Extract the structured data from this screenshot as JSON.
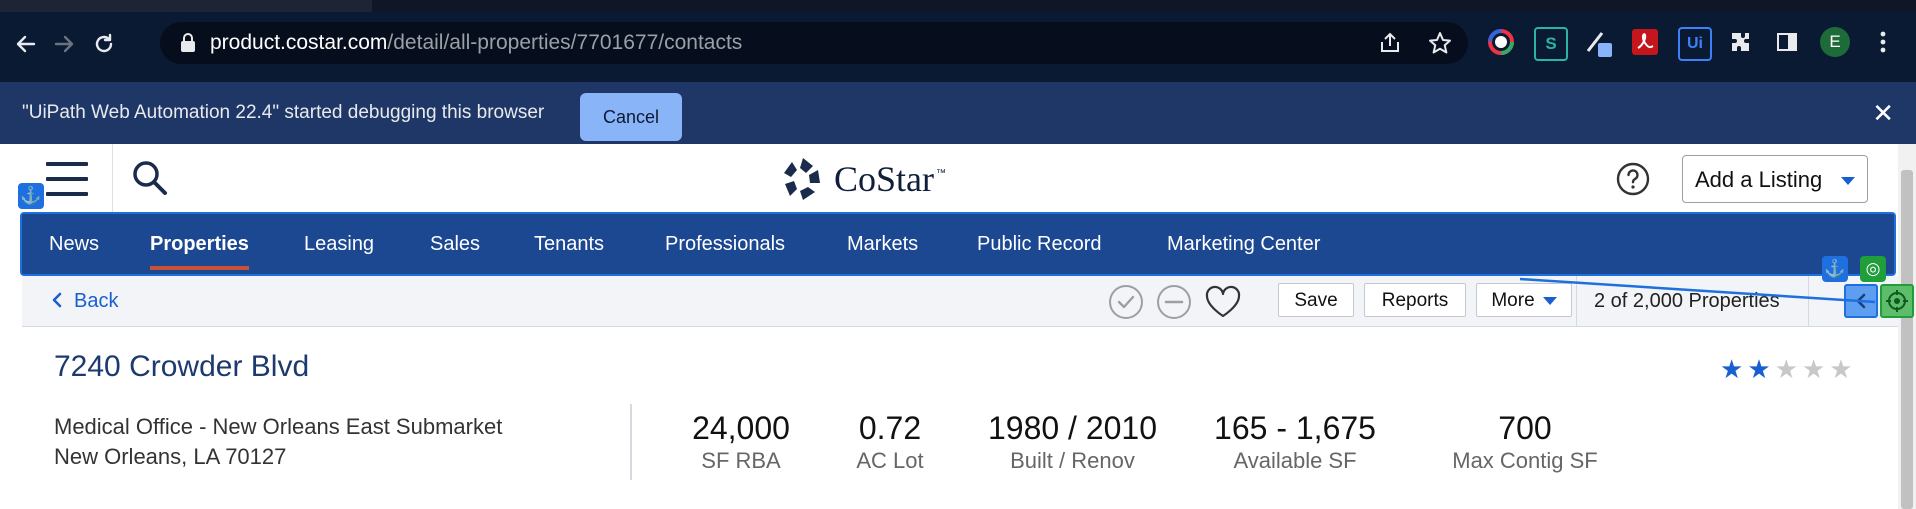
{
  "browser": {
    "url_domain": "product.costar.com",
    "url_path": "/detail/all-properties/7701677/contacts",
    "profile_initial": "E",
    "extensions": [
      "color-picker-icon",
      "s-extension-icon",
      "pen-extension-icon",
      "pdf-extension-icon",
      "uipath-extension-icon",
      "puzzle-icon",
      "sidepanel-icon"
    ]
  },
  "infobar": {
    "message": "\"UiPath Web Automation 22.4\" started debugging this browser",
    "cancel_label": "Cancel",
    "close_symbol": "✕"
  },
  "header": {
    "brand": "CoStar",
    "trademark": "™",
    "add_listing_label": "Add a Listing"
  },
  "nav": {
    "items": [
      {
        "label": "News"
      },
      {
        "label": "Properties"
      },
      {
        "label": "Leasing"
      },
      {
        "label": "Sales"
      },
      {
        "label": "Tenants"
      },
      {
        "label": "Professionals"
      },
      {
        "label": "Markets"
      },
      {
        "label": "Public Record"
      },
      {
        "label": "Marketing Center"
      }
    ],
    "active": "Properties"
  },
  "actions": {
    "back_label": "Back",
    "save_label": "Save",
    "reports_label": "Reports",
    "more_label": "More",
    "pager_text": "2 of 2,000 Properties"
  },
  "property": {
    "title": "7240 Crowder Blvd",
    "rating": 2,
    "rating_max": 5,
    "address_line1": "Medical Office - New Orleans East Submarket",
    "address_line2": "New Orleans, LA 70127",
    "stats": [
      {
        "value": "24,000",
        "label": "SF RBA"
      },
      {
        "value": "0.72",
        "label": "AC Lot"
      },
      {
        "value": "1980 / 2010",
        "label": "Built / Renov"
      },
      {
        "value": "165 - 1,675",
        "label": "Available SF"
      },
      {
        "value": "700",
        "label": "Max Contig SF"
      }
    ]
  },
  "colors": {
    "nav_bg": "#1c4791",
    "accent": "#1a5fd0",
    "active_underline": "#c9513a",
    "star_filled": "#1a5fd0",
    "star_empty": "#c8c8c8"
  }
}
